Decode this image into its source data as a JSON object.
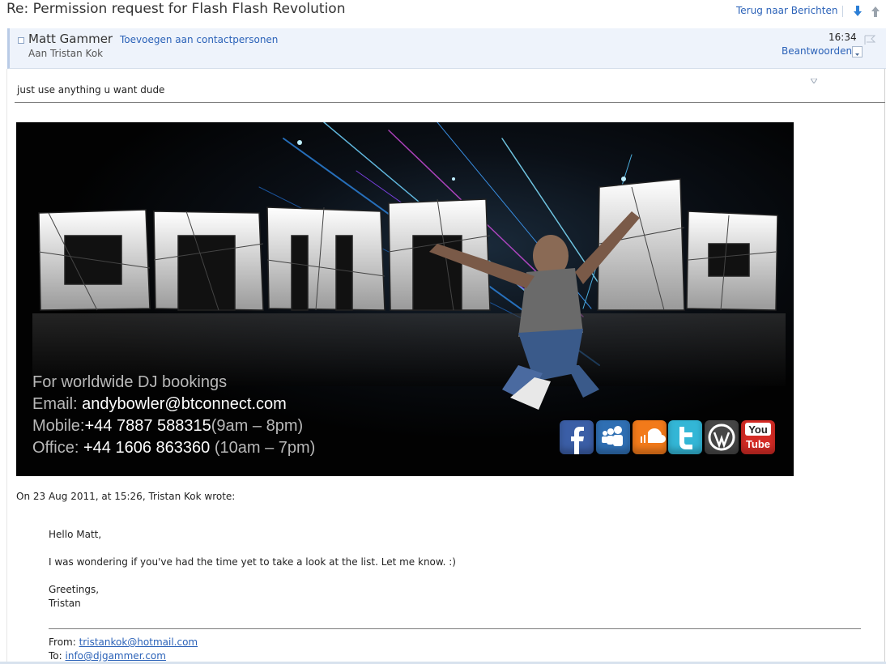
{
  "subject": "Re: Permission request for Flash Flash Revolution",
  "toolbar": {
    "back_label": "Terug naar Berichten",
    "next_icon": "arrow-down-icon",
    "prev_icon": "arrow-up-icon"
  },
  "header": {
    "sender": "Matt Gammer",
    "add_contact": "Toevoegen aan contactpersonen",
    "recipient": "Aan Tristan Kok",
    "time": "16:34",
    "reply_label": "Beantwoorden"
  },
  "message": {
    "body": "just use anything u want dude"
  },
  "banner": {
    "line1": "For worldwide DJ bookings",
    "email_label": "Email: ",
    "email_value": "andybowler@btconnect.com",
    "mobile_label": "Mobile:",
    "mobile_value": "+44 7887 588315",
    "mobile_hours": "(9am – 8pm)",
    "office_label": "Office: ",
    "office_value": "+44 1606 863360",
    "office_hours": " (10am – 7pm)",
    "social": [
      {
        "name": "facebook-icon",
        "color": "#3b5ea6"
      },
      {
        "name": "myspace-icon",
        "color": "#2f6fb3"
      },
      {
        "name": "soundcloud-icon",
        "color": "#f27a1a"
      },
      {
        "name": "twitter-icon",
        "color": "#33b6d6"
      },
      {
        "name": "wordpress-icon",
        "color": "#464646"
      },
      {
        "name": "youtube-icon",
        "color": "#d42b25",
        "label_top": "You",
        "label_bottom": "Tube"
      }
    ]
  },
  "quote": {
    "intro": "On 23 Aug 2011, at 15:26, Tristan Kok wrote:",
    "greeting": "Hello Matt,",
    "line": "I was wondering if you've had the time yet to take a look at the list. Let me know. :)",
    "closing1": "Greetings,",
    "closing2": "Tristan",
    "from_label": "From: ",
    "from_value": "tristankok@hotmail.com",
    "to_label": "To: ",
    "to_value": "info@djgammer.com"
  },
  "colors": {
    "link": "#2b62b8",
    "header_bg": "#eef3fb"
  }
}
